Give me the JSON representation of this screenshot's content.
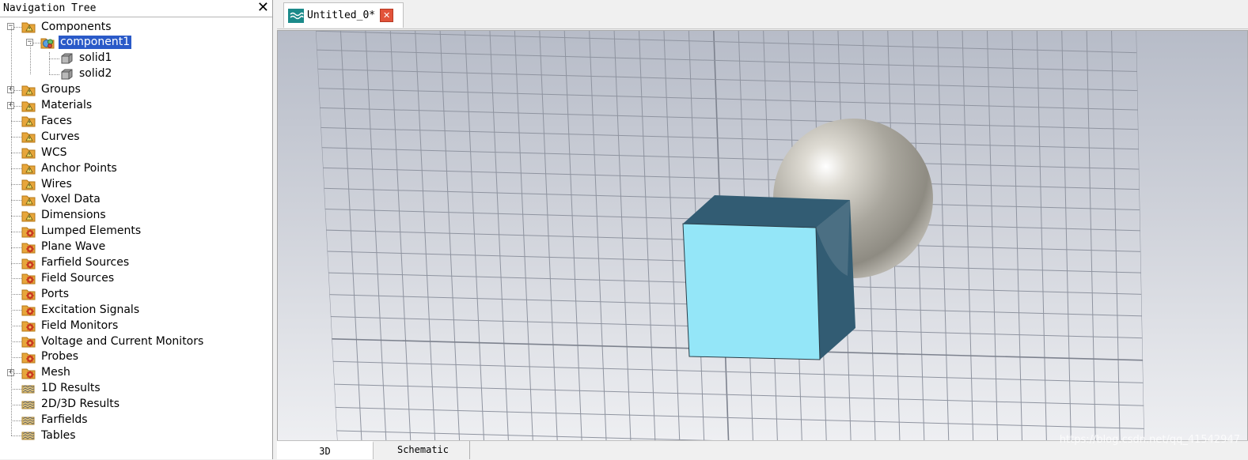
{
  "nav": {
    "title": "Navigation Tree",
    "close_glyph": "✕",
    "items": [
      {
        "label": "Components",
        "icon": "folder-warning-icon",
        "expander": "−"
      },
      {
        "label": "component1",
        "icon": "component-icon",
        "expander": "−",
        "selected": true
      },
      {
        "label": "solid1",
        "icon": "solid-cube-icon"
      },
      {
        "label": "solid2",
        "icon": "solid-cube-icon"
      },
      {
        "label": "Groups",
        "icon": "folder-warning-icon",
        "expander": "+"
      },
      {
        "label": "Materials",
        "icon": "folder-warning-icon",
        "expander": "+"
      },
      {
        "label": "Faces",
        "icon": "folder-warning-icon"
      },
      {
        "label": "Curves",
        "icon": "folder-warning-icon"
      },
      {
        "label": "WCS",
        "icon": "folder-warning-icon"
      },
      {
        "label": "Anchor Points",
        "icon": "folder-warning-icon"
      },
      {
        "label": "Wires",
        "icon": "folder-warning-icon"
      },
      {
        "label": "Voxel Data",
        "icon": "folder-warning-icon"
      },
      {
        "label": "Dimensions",
        "icon": "folder-warning-icon"
      },
      {
        "label": "Lumped Elements",
        "icon": "folder-gear-icon"
      },
      {
        "label": "Plane Wave",
        "icon": "folder-gear-icon"
      },
      {
        "label": "Farfield Sources",
        "icon": "folder-gear-icon"
      },
      {
        "label": "Field Sources",
        "icon": "folder-gear-icon"
      },
      {
        "label": "Ports",
        "icon": "folder-gear-icon"
      },
      {
        "label": "Excitation Signals",
        "icon": "folder-gear-icon"
      },
      {
        "label": "Field Monitors",
        "icon": "folder-gear-icon"
      },
      {
        "label": "Voltage and Current Monitors",
        "icon": "folder-gear-icon"
      },
      {
        "label": "Probes",
        "icon": "folder-gear-icon"
      },
      {
        "label": "Mesh",
        "icon": "folder-gear-icon",
        "expander": "+"
      },
      {
        "label": "1D Results",
        "icon": "results-folder-icon"
      },
      {
        "label": "2D/3D Results",
        "icon": "results-folder-icon"
      },
      {
        "label": "Farfields",
        "icon": "results-folder-icon"
      },
      {
        "label": "Tables",
        "icon": "results-folder-icon"
      }
    ]
  },
  "tab": {
    "label": "Untitled_0*",
    "icon": "cst-project-icon",
    "close_glyph": "✕"
  },
  "viewport": {
    "cube_front_color": "#94e6f8",
    "cube_side_color": "#325c73",
    "sphere_color": "#a8a59c"
  },
  "bottom_tabs": {
    "tab_3d": "3D",
    "tab_schematic": "Schematic"
  },
  "watermark": "https://blog.csdn.net/qq_41542947"
}
